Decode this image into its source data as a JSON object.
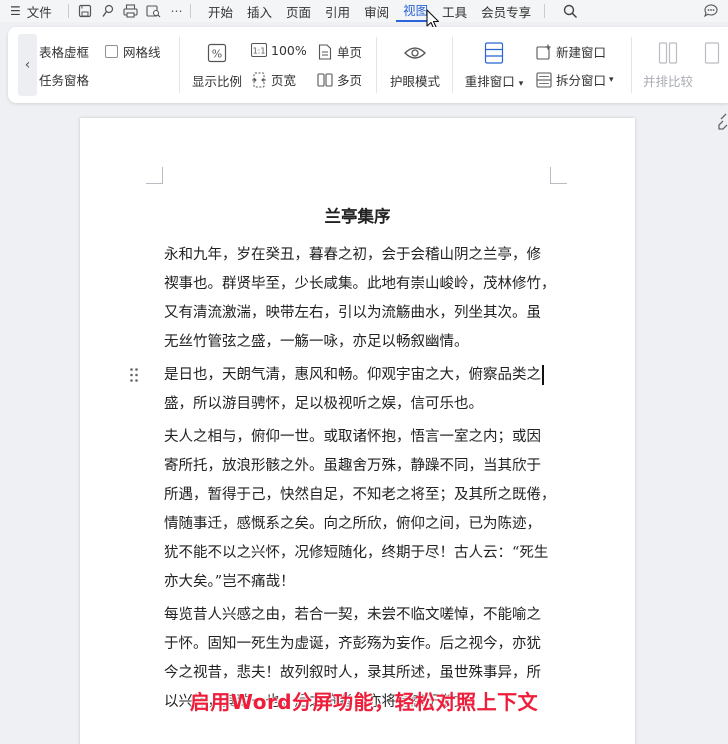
{
  "menubar": {
    "file_label": "文件",
    "menus": [
      "开始",
      "插入",
      "页面",
      "引用",
      "审阅",
      "视图",
      "工具",
      "会员专享"
    ],
    "active_menu": "视图",
    "accent": "#2a64d6"
  },
  "ribbon": {
    "table_gridlines": "表格虚框",
    "gridlines": "网格线",
    "task_pane": "任务窗格",
    "display_ratio": "显示比例",
    "zoom_100": "100%",
    "page_width": "页宽",
    "single_page": "单页",
    "multi_page": "多页",
    "eye_protection": "护眼模式",
    "rearrange_windows": "重排窗口",
    "new_window": "新建窗口",
    "split_window": "拆分窗口",
    "side_by_side": "并排比较"
  },
  "document": {
    "title": "兰亭集序",
    "paragraphs": [
      [
        "永和九年，岁在癸丑，暮春之初，会于会稽山阴之兰亭，修",
        "禊事也。群贤毕至，少长咸集。此地有崇山峻岭，茂林修竹，",
        "又有清流激湍，映带左右，引以为流觞曲水，列坐其次。虽",
        "无丝竹管弦之盛，一觞一咏，亦足以畅叙幽情。"
      ],
      [
        "是日也，天朗气清，惠风和畅。仰观宇宙之大，俯察品类之",
        "盛，所以游目骋怀，足以极视听之娱，信可乐也。"
      ],
      [
        "夫人之相与，俯仰一世。或取诸怀抱，悟言一室之内；或因",
        "寄所托，放浪形骸之外。虽趣舍万殊，静躁不同，当其欣于",
        "所遇，暂得于己，快然自足，不知老之将至；及其所之既倦，",
        "情随事迁，感慨系之矣。向之所欣，俯仰之间，已为陈迹，",
        "犹不能不以之兴怀，况修短随化，终期于尽！古人云：“死生",
        "亦大矣。”岂不痛哉！"
      ],
      [
        "每览昔人兴感之由，若合一契，未尝不临文嗟悼，不能喻之",
        "于怀。固知一死生为虚诞，齐彭殇为妄作。后之视今，亦犹",
        "今之视昔，悲夫！故列叙时人，录其所述，虽世殊事异，所",
        "以兴怀，其致一也。后之览者，亦将有感于斯文。"
      ]
    ]
  },
  "caption": "启用Word分屏功能，轻松对照上下文",
  "colors": {
    "caption": "#ee1d3a",
    "page": "#ffffff",
    "workspace": "#eef0f3"
  }
}
